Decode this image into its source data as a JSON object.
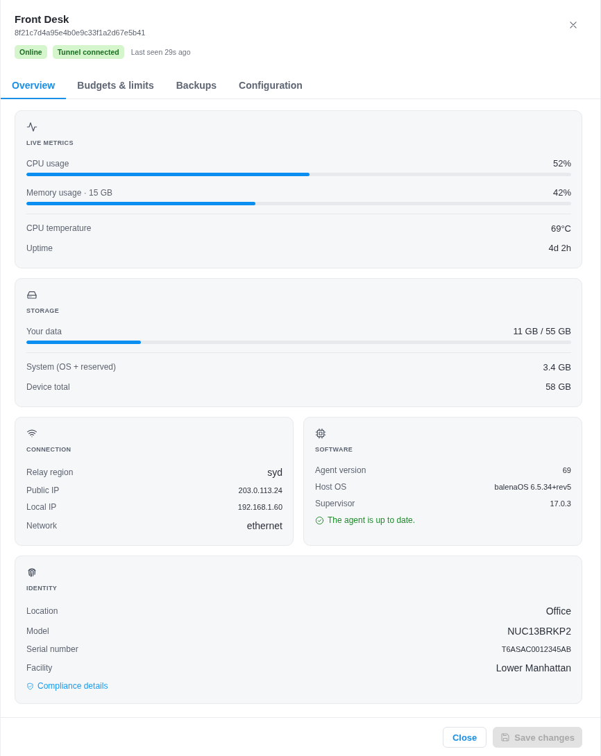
{
  "header": {
    "name": "Front Desk",
    "id": "8f21c7d4a95e4b0e9c33f1a2d67e5b41",
    "badges": [
      "Online",
      "Tunnel connected"
    ],
    "last_seen": "Last seen 29s ago"
  },
  "tabs": [
    {
      "label": "Overview",
      "selected": true
    },
    {
      "label": "Budgets & limits",
      "selected": false
    },
    {
      "label": "Backups",
      "selected": false
    },
    {
      "label": "Configuration",
      "selected": false
    }
  ],
  "live_metrics": {
    "title": "LIVE METRICS",
    "meters": [
      {
        "label": "CPU usage",
        "reading": "52%",
        "level": 0.52
      },
      {
        "label": "Memory usage · 15 GB",
        "reading": "42%",
        "level": 0.42
      }
    ],
    "stats": [
      {
        "label": "CPU temperature",
        "value": "69°C"
      },
      {
        "label": "Uptime",
        "value": "4d 2h"
      }
    ]
  },
  "storage": {
    "title": "STORAGE",
    "meters": [
      {
        "label": "Your data",
        "reading": "11 GB / 55 GB",
        "level": 0.21
      }
    ],
    "stats": [
      {
        "label": "System (OS + reserved)",
        "value": "3.4 GB"
      },
      {
        "label": "Device total",
        "value": "58 GB"
      }
    ]
  },
  "connection": {
    "title": "CONNECTION",
    "rows": [
      {
        "label": "Relay region",
        "value": "syd",
        "kind": "text"
      },
      {
        "label": "Public IP",
        "value": "203.0.113.24",
        "kind": "code"
      },
      {
        "label": "Local IP",
        "value": "192.168.1.60",
        "kind": "code"
      },
      {
        "label": "Network",
        "value": "ethernet",
        "kind": "text"
      }
    ]
  },
  "software": {
    "title": "SOFTWARE",
    "rows": [
      {
        "label": "Agent version",
        "value": "69",
        "kind": "code"
      },
      {
        "label": "Host OS",
        "value": "balenaOS 6.5.34+rev5",
        "kind": "code"
      },
      {
        "label": "Supervisor",
        "value": "17.0.3",
        "kind": "code"
      }
    ],
    "status": "The agent is up to date."
  },
  "identity": {
    "title": "IDENTITY",
    "rows": [
      {
        "label": "Location",
        "value": "Office",
        "kind": "text"
      },
      {
        "label": "Model",
        "value": "NUC13BRKP2",
        "kind": "text"
      },
      {
        "label": "Serial number",
        "value": "T6ASAC0012345AB",
        "kind": "code"
      },
      {
        "label": "Facility",
        "value": "Lower Manhattan",
        "kind": "text"
      }
    ],
    "link": "Compliance details"
  },
  "footer": {
    "buttons": [
      {
        "label": "Close",
        "kind": "secondary",
        "disabled": false
      },
      {
        "label": "Save changes",
        "kind": "primary",
        "disabled": true
      }
    ]
  }
}
